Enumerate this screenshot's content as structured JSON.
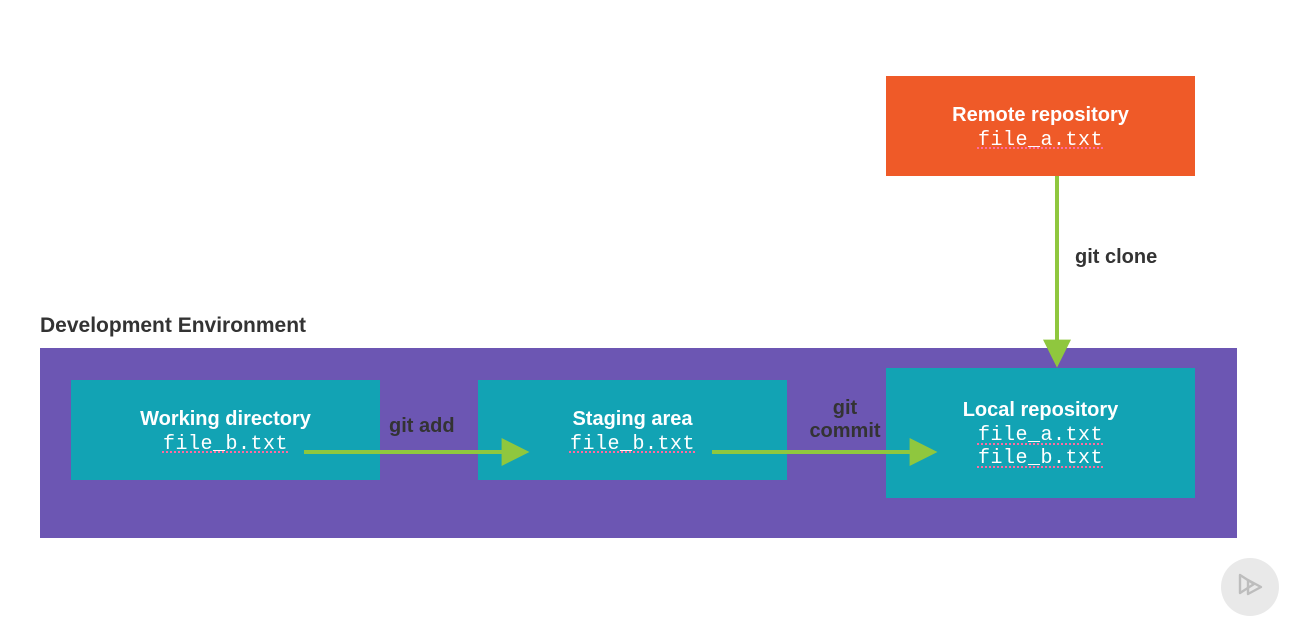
{
  "remote": {
    "title": "Remote repository",
    "files": [
      "file_a.txt"
    ]
  },
  "dev_env_label": "Development Environment",
  "working": {
    "title": "Working directory",
    "files": [
      "file_b.txt"
    ]
  },
  "staging": {
    "title": "Staging area",
    "files": [
      "file_b.txt"
    ]
  },
  "local": {
    "title": "Local repository",
    "files": [
      "file_a.txt",
      "file_b.txt"
    ]
  },
  "commands": {
    "clone": "git clone",
    "add": "git add",
    "commit_l1": "git",
    "commit_l2": "commit"
  },
  "colors": {
    "teal": "#12a3b4",
    "orange": "#ef5a28",
    "purple": "#6c56b3",
    "arrow": "#8fc73e"
  }
}
